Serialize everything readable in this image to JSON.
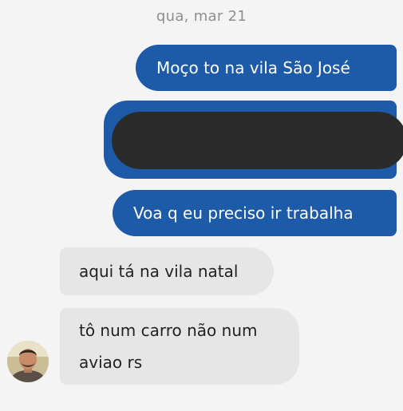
{
  "date_separator": "qua, mar 21",
  "messages": [
    {
      "direction": "sent",
      "text": "Moço to na vila São José"
    },
    {
      "direction": "sent",
      "text": ""
    },
    {
      "direction": "sent",
      "text": "Voa q eu preciso ir trabalha"
    },
    {
      "direction": "received",
      "text": "aqui tá na vila natal"
    },
    {
      "direction": "received",
      "text": "tô num carro não num\naviao rs"
    }
  ],
  "colors": {
    "sent_bubble": "#1d5aa8",
    "received_bubble": "#e6e6e6",
    "background": "#f4f4f4",
    "redaction": "#2b2b2b"
  },
  "avatar": {
    "icon": "contact-photo"
  }
}
